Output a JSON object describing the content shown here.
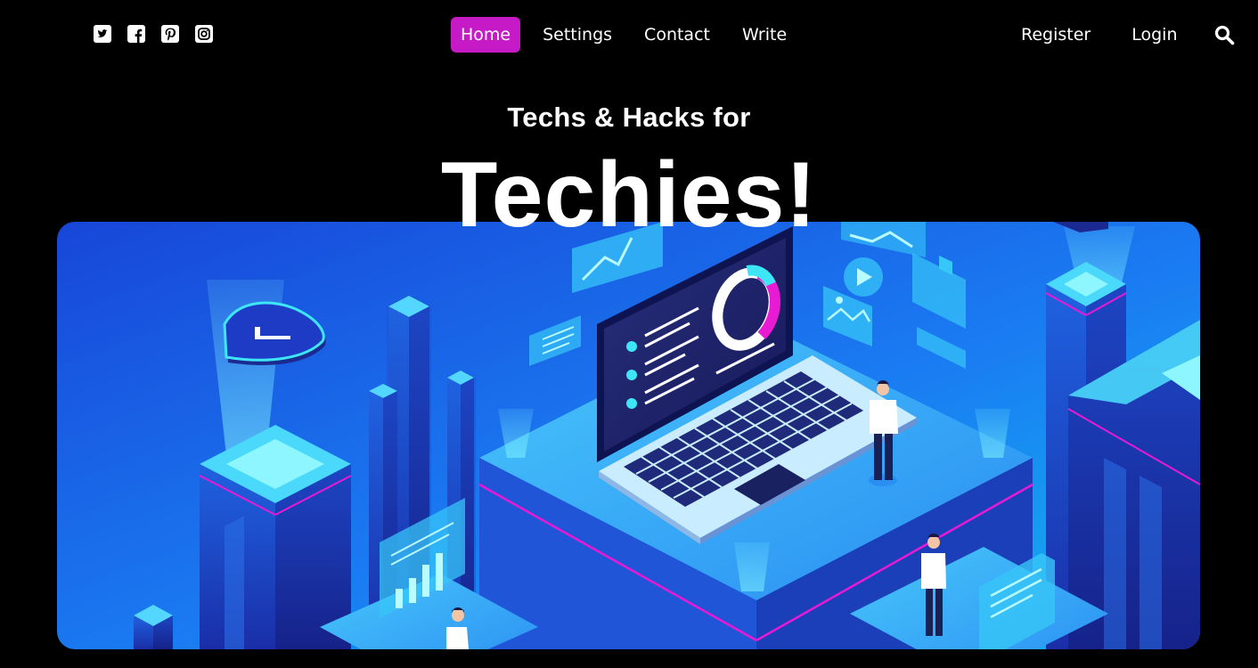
{
  "social": {
    "icons": [
      "twitter-icon",
      "facebook-icon",
      "pinterest-icon",
      "instagram-icon"
    ]
  },
  "nav": {
    "items": [
      {
        "label": "Home",
        "active": true
      },
      {
        "label": "Settings",
        "active": false
      },
      {
        "label": "Contact",
        "active": false
      },
      {
        "label": "Write",
        "active": false
      }
    ]
  },
  "auth": {
    "register": "Register",
    "login": "Login"
  },
  "search": {
    "icon": "search-icon"
  },
  "hero": {
    "subtitle": "Techs & Hacks for",
    "title": "Techies!"
  },
  "colors": {
    "accent": "#c61ac6",
    "background": "#000000",
    "hero_blue": "#1a6bf0",
    "hero_cyan": "#3ee6f5",
    "hero_magenta": "#e81ad4"
  }
}
